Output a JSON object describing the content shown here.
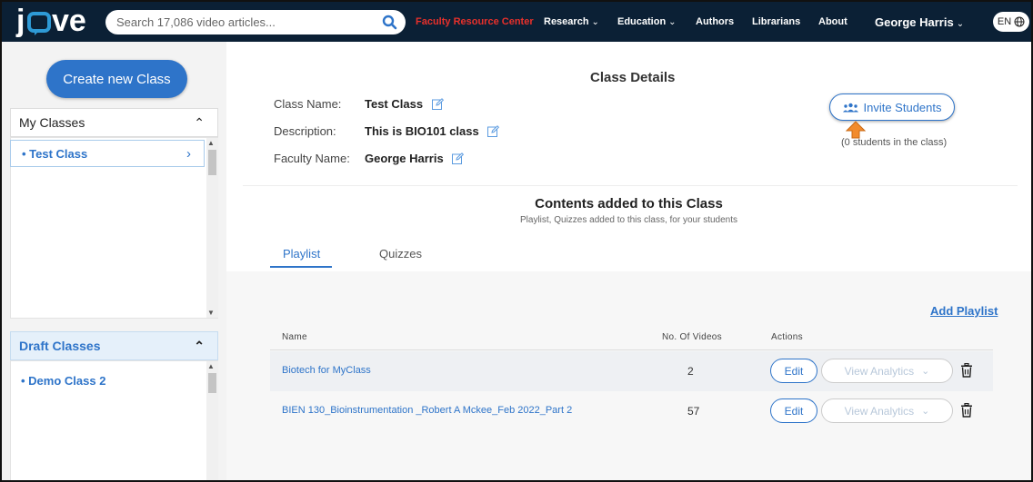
{
  "topbar": {
    "logo_text": "jove",
    "search_placeholder": "Search 17,086 video articles...",
    "nav": {
      "faculty": "Faculty Resource Center",
      "research": "Research",
      "education": "Education",
      "authors": "Authors",
      "librarians": "Librarians",
      "about": "About",
      "user": "George Harris",
      "lang": "EN"
    }
  },
  "sidebar": {
    "create_label": "Create new Class",
    "my_classes": {
      "header": "My Classes",
      "items": [
        {
          "label": "Test Class"
        }
      ]
    },
    "draft_classes": {
      "header": "Draft Classes",
      "items": [
        {
          "label": "Demo Class 2"
        }
      ]
    }
  },
  "details": {
    "title": "Class Details",
    "class_name_label": "Class Name:",
    "class_name": "Test Class",
    "description_label": "Description:",
    "description": "This is BIO101 class",
    "faculty_label": "Faculty Name:",
    "faculty_name": "George Harris",
    "invite_label": "Invite Students",
    "students_count": "(0 students in the class)"
  },
  "contents": {
    "title": "Contents added to this Class",
    "subtitle": "Playlist, Quizzes added to this class, for your students",
    "tabs": [
      {
        "label": "Playlist"
      },
      {
        "label": "Quizzes"
      }
    ],
    "add_playlist": "Add Playlist",
    "columns": {
      "name": "Name",
      "count": "No. Of Videos",
      "actions": "Actions"
    },
    "rows": [
      {
        "name": "Biotech for MyClass",
        "count": "2"
      },
      {
        "name": "BIEN 130_Bioinstrumentation _Robert A Mckee_Feb 2022_Part 2",
        "count": "57"
      }
    ],
    "edit_label": "Edit",
    "analytics_label": "View Analytics"
  },
  "colors": {
    "nav_bg": "#0b2035",
    "brand_blue": "#2e74c9",
    "faculty_red": "#e8302b",
    "pointer_orange": "#f28b2c"
  },
  "icons": [
    "search-icon",
    "chevron-down-icon",
    "globe-icon",
    "chevron-up-icon",
    "chevron-right-icon",
    "pencil-icon",
    "people-icon",
    "arrow-up-icon",
    "trash-icon"
  ]
}
